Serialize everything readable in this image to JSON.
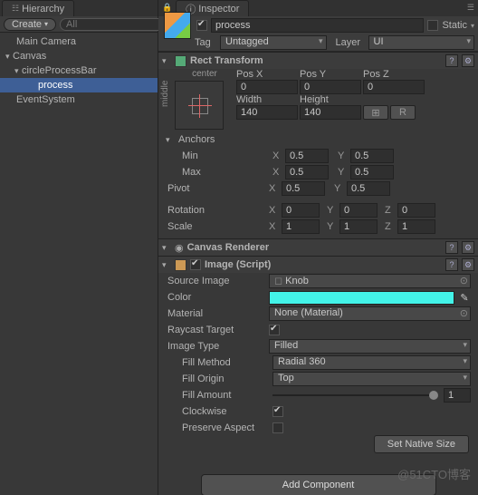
{
  "hierarchy": {
    "tab": "Hierarchy",
    "create": "Create",
    "search_placeholder": "All",
    "items": [
      "Main Camera",
      "Canvas",
      "circleProcessBar",
      "process",
      "EventSystem"
    ]
  },
  "inspector": {
    "tab": "Inspector",
    "name": "process",
    "static": "Static",
    "tag_label": "Tag",
    "tag_value": "Untagged",
    "layer_label": "Layer",
    "layer_value": "UI"
  },
  "rect": {
    "title": "Rect Transform",
    "mode": "center",
    "side_label": "middle",
    "posx": "Pos X",
    "posy": "Pos Y",
    "posz": "Pos Z",
    "posx_v": "0",
    "posy_v": "0",
    "posz_v": "0",
    "width": "Width",
    "height": "Height",
    "width_v": "140",
    "height_v": "140",
    "r_btn": "R",
    "anchors": "Anchors",
    "min": "Min",
    "max": "Max",
    "pivot": "Pivot",
    "min_x": "0.5",
    "min_y": "0.5",
    "max_x": "0.5",
    "max_y": "0.5",
    "piv_x": "0.5",
    "piv_y": "0.5",
    "rotation": "Rotation",
    "rot_x": "0",
    "rot_y": "0",
    "rot_z": "0",
    "scale": "Scale",
    "scl_x": "1",
    "scl_y": "1",
    "scl_z": "1"
  },
  "canvas_r": {
    "title": "Canvas Renderer"
  },
  "image": {
    "title": "Image (Script)",
    "source": "Source Image",
    "source_v": "Knob",
    "color": "Color",
    "color_hex": "#43f3e8",
    "material": "Material",
    "material_v": "None (Material)",
    "raycast": "Raycast Target",
    "type": "Image Type",
    "type_v": "Filled",
    "fill_method": "Fill Method",
    "fill_method_v": "Radial 360",
    "fill_origin": "Fill Origin",
    "fill_origin_v": "Top",
    "fill_amount": "Fill Amount",
    "fill_amount_v": "1",
    "clockwise": "Clockwise",
    "preserve": "Preserve Aspect",
    "set_native": "Set Native Size"
  },
  "add_component": "Add Component",
  "watermark": "@51CTO博客"
}
